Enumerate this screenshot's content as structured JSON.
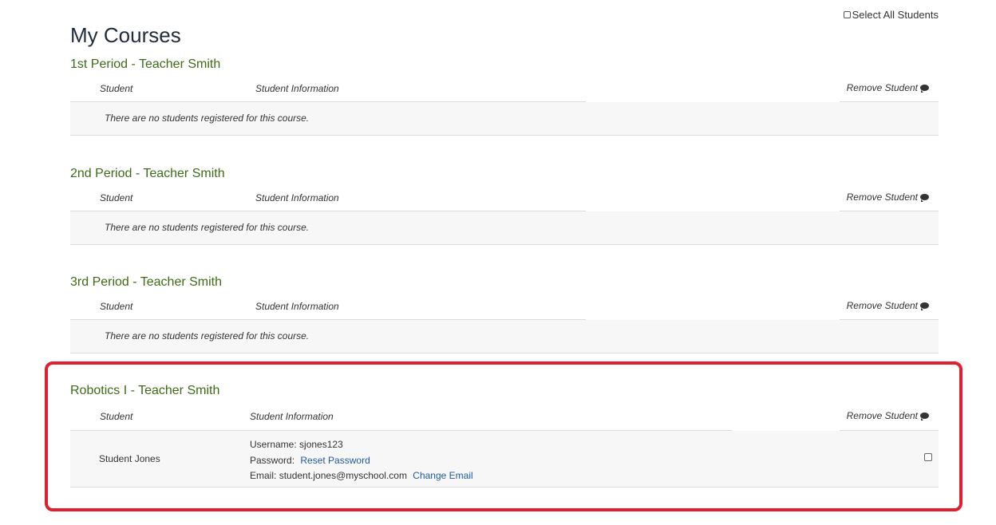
{
  "header": {
    "select_all_label": "Select All Students",
    "page_title": "My Courses"
  },
  "columns": {
    "student": "Student",
    "info": "Student Information",
    "remove": "Remove Student"
  },
  "empty_message": "There are no students registered for this course.",
  "courses": [
    {
      "title": "1st Period - Teacher Smith"
    },
    {
      "title": "2nd Period - Teacher Smith"
    },
    {
      "title": "3rd Period - Teacher Smith"
    },
    {
      "title": "Robotics I - Teacher Smith",
      "student": {
        "name": "Student Jones",
        "username_label": "Username:",
        "username": "sjones123",
        "password_label": "Password:",
        "reset_password": "Reset Password",
        "email_label": "Email:",
        "email": "student.jones@myschool.com",
        "change_email": "Change Email"
      }
    }
  ],
  "colors": {
    "course_title": "#3d6b16",
    "link": "#1f5a9c",
    "highlight": "#e0202e"
  }
}
